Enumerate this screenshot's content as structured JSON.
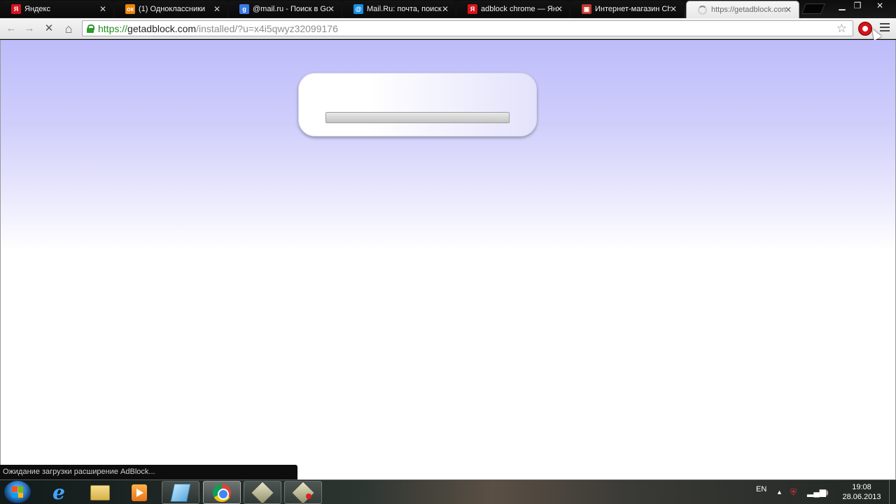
{
  "browser": {
    "tabs": [
      {
        "title": "Яндекс",
        "favicon": "yandex-icon",
        "favicon_glyph": "Я",
        "favicon_color": "#d6131b",
        "active": false
      },
      {
        "title": "(1) Одноклассники",
        "favicon": "odnoklassniki-icon",
        "favicon_glyph": "ок",
        "favicon_color": "#ee8208",
        "active": false
      },
      {
        "title": "@mail.ru - Поиск в Google",
        "favicon": "google-icon",
        "favicon_glyph": "g",
        "favicon_color": "#3b78e7",
        "active": false
      },
      {
        "title": "Mail.Ru: почта, поиск",
        "favicon": "mailru-icon",
        "favicon_glyph": "@",
        "favicon_color": "#168de2",
        "active": false
      },
      {
        "title": "adblock chrome — Яндекс",
        "favicon": "yandex-icon",
        "favicon_glyph": "Я",
        "favicon_color": "#d6131b",
        "active": false
      },
      {
        "title": "Интернет-магазин Chrome",
        "favicon": "chrome-store-icon",
        "favicon_glyph": "▣",
        "favicon_color": "#c0392b",
        "active": false
      },
      {
        "title": "https://getadblock.com",
        "favicon": "loading-spinner-icon",
        "favicon_glyph": "",
        "favicon_color": "#8a8a8a",
        "active": true
      }
    ],
    "window_controls": {
      "minimize": "▁",
      "maximize": "❐",
      "close": "✕"
    },
    "toolbar": {
      "back": "←",
      "forward": "→",
      "stop": "✕",
      "home": "⌂",
      "url_scheme": "https://",
      "url_host": "getadblock.com",
      "url_path": "/installed/?u=x4i5qwyz32099176",
      "bookmark_star": "☆"
    },
    "status_bubble": "Ожидание загрузки расширение AdBlock..."
  },
  "page": {
    "progress_fraction": 1.0
  },
  "taskbar": {
    "apps": [
      "internet-explorer",
      "windows-explorer",
      "media-player",
      "notepad",
      "chrome",
      "app-generic",
      "app-recording"
    ],
    "language": "EN",
    "time": "19:08",
    "date": "28.06.2013"
  }
}
